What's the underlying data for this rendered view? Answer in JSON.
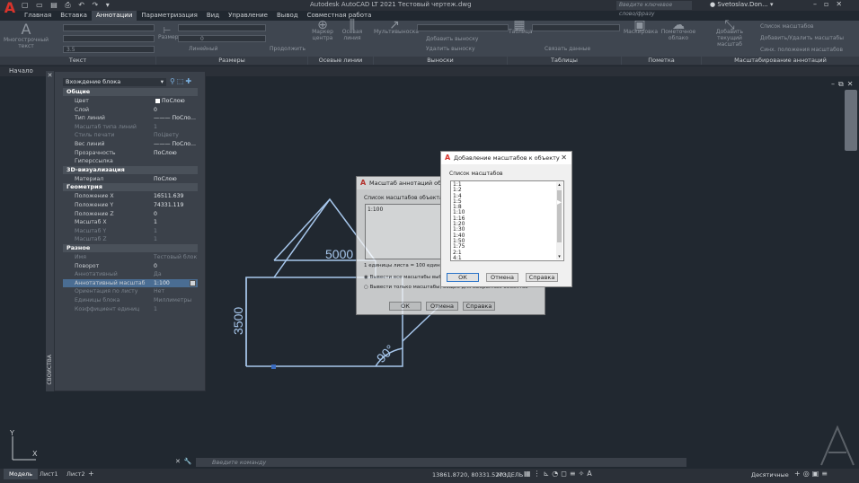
{
  "window": {
    "app_letter": "A",
    "title": "Autodesk AutoCAD LT 2021   Тестовый чертеж.dwg",
    "search_placeholder": "Введите ключевое слово/фразу",
    "user": "Svetoslav.Don..."
  },
  "ribbon": {
    "tabs": [
      "Главная",
      "Вставка",
      "Аннотации",
      "Параметризация",
      "Вид",
      "Управление",
      "Вывод",
      "Совместная работа"
    ],
    "active_tab": "Аннотации",
    "buttons": {
      "multiline_text": "Многострочный текст",
      "dimension": "Размер",
      "center_mark": "Маркер центра",
      "center_line": "Осевая линия",
      "multileader": "Мультивыноска",
      "add_leader": "Добавить выноску",
      "remove_leader": "Удалить выноску",
      "table": "Таблица",
      "link_data": "Связать данные",
      "masking": "Маскировка",
      "revision_cloud": "Пометочное облако",
      "add_current_scale": "Добавить текущий масштаб",
      "scale_list": "Список масштабов",
      "add_delete_scales": "Добавить/Удалить масштабы",
      "sync_positions": "Синх. положения масштабов",
      "text_height": "3.5",
      "linear": "Линейный",
      "continue": "Продолжить",
      "layer": "0"
    },
    "panels": [
      "Текст",
      "Размеры",
      "Осевые линии",
      "Выноски",
      "Таблицы",
      "Пометка",
      "Масштабирование аннотаций"
    ]
  },
  "doc_tabs": {
    "start": "Начало"
  },
  "properties": {
    "title": "СВОЙСТВА",
    "selection": "Вхождение блока",
    "sections": [
      {
        "name": "Общие",
        "rows": [
          {
            "k": "Цвет",
            "v": "ПоСлою"
          },
          {
            "k": "Слой",
            "v": "0"
          },
          {
            "k": "Тип линий",
            "v": "——— ПоСло..."
          },
          {
            "k": "Масштаб типа линий",
            "v": "1",
            "dim": true
          },
          {
            "k": "Стиль печати",
            "v": "ПоЦвету",
            "dim": true
          },
          {
            "k": "Вес линий",
            "v": "——— ПоСло..."
          },
          {
            "k": "Прозрачность",
            "v": "ПоСлою"
          },
          {
            "k": "Гиперссылка",
            "v": ""
          }
        ]
      },
      {
        "name": "3D-визуализация",
        "rows": [
          {
            "k": "Материал",
            "v": "ПоСлою"
          }
        ]
      },
      {
        "name": "Геометрия",
        "rows": [
          {
            "k": "Положение X",
            "v": "16511.639"
          },
          {
            "k": "Положение Y",
            "v": "74331.119"
          },
          {
            "k": "Положение Z",
            "v": "0"
          },
          {
            "k": "Масштаб X",
            "v": "1"
          },
          {
            "k": "Масштаб Y",
            "v": "1",
            "dim": true
          },
          {
            "k": "Масштаб Z",
            "v": "1",
            "dim": true
          }
        ]
      },
      {
        "name": "Разное",
        "rows": [
          {
            "k": "Имя",
            "v": "Тестовый блок",
            "dim": true
          },
          {
            "k": "Поворот",
            "v": "0"
          },
          {
            "k": "Аннотативный",
            "v": "Да",
            "dim": true
          },
          {
            "k": "Аннотативный масштаб",
            "v": "1:100",
            "sel": true
          },
          {
            "k": "Ориентация по листу",
            "v": "Нет",
            "dim": true
          },
          {
            "k": "Единицы блока",
            "v": "Миллиметры",
            "dim": true
          },
          {
            "k": "Коэффициент единиц",
            "v": "1",
            "dim": true
          }
        ]
      }
    ]
  },
  "drawing": {
    "dim_top": "5000",
    "dim_left": "3500",
    "angle": "90°"
  },
  "dialog_object_scale": {
    "title": "Масштаб аннотаций объекта",
    "list_label": "Список масштабов объекта",
    "items": [
      "1:100"
    ],
    "units_line": "1 единицы листа = 100 единиц че",
    "radio_all": "Вывести все масштабы выбр",
    "radio_common": "Вывести только масштабы, общие для выбранных объектов",
    "ok": "ОК",
    "cancel": "Отмена",
    "help": "Справка"
  },
  "dialog_add_scales": {
    "title": "Добавление масштабов к объекту",
    "list_label": "Список масштабов",
    "items": [
      "1:1",
      "1:2",
      "1:4",
      "1:5",
      "1:8",
      "1:10",
      "1:16",
      "1:20",
      "1:30",
      "1:40",
      "1:50",
      "1:75",
      "2:1",
      "4:1"
    ],
    "ok": "ОК",
    "cancel": "Отмена",
    "help": "Справка"
  },
  "command_line": {
    "placeholder": "Введите команду"
  },
  "layout_tabs": [
    "Модель",
    "Лист1",
    "Лист2"
  ],
  "status": {
    "coords": "13861.8720, 80331.5273",
    "model": "МОДЕЛЬ",
    "units": "Десятичные"
  },
  "ucs": {
    "x": "X",
    "y": "Y"
  }
}
